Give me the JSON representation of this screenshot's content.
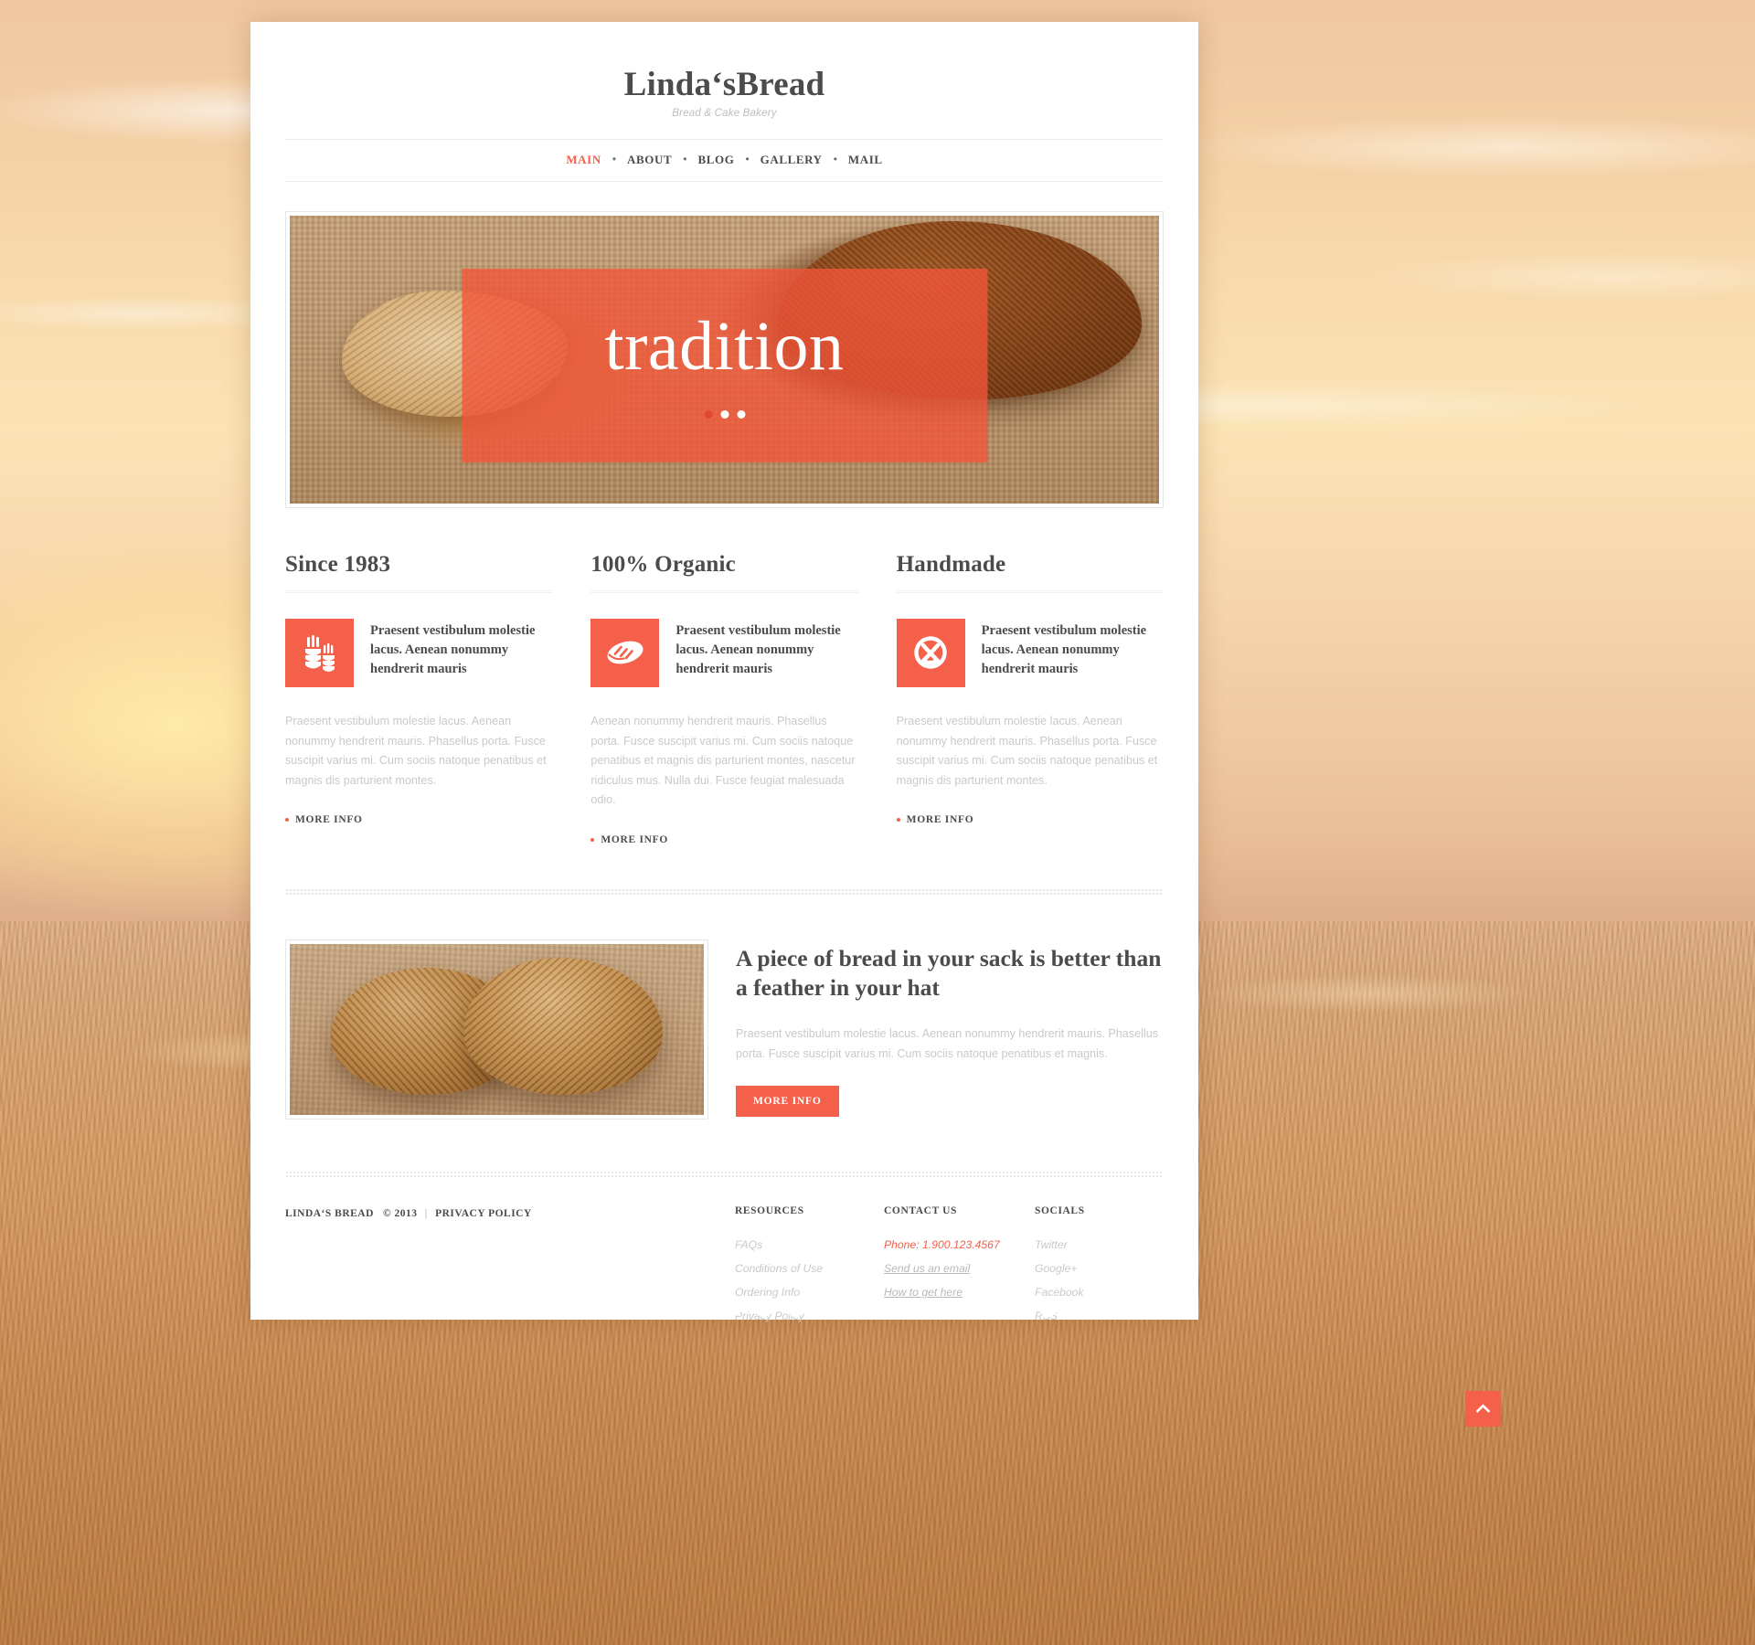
{
  "theme": {
    "accent": "#f4604a",
    "heading_color": "#4b4b4b",
    "muted_text": "#c9c9c9",
    "page_bg": "#ffffff"
  },
  "header": {
    "logo_title": "Linda‘sBread",
    "logo_tagline": "Bread & Cake Bakery"
  },
  "nav": {
    "separator": "•",
    "items": [
      {
        "label": "MAIN",
        "active": true
      },
      {
        "label": "ABOUT",
        "active": false
      },
      {
        "label": "BLOG",
        "active": false
      },
      {
        "label": "GALLERY",
        "active": false
      },
      {
        "label": "MAIL",
        "active": false
      }
    ]
  },
  "hero": {
    "title": "tradition",
    "slide_count": 3,
    "active_slide": 1,
    "overlay_color": "#f45439",
    "image_alt": "Sliced dark rye bread loaf on burlap cloth"
  },
  "features": [
    {
      "title": "Since 1983",
      "icon": "wheat-icon",
      "lead": "Praesent vestibulum molestie lacus. Aenean nonummy hendrerit mauris",
      "body": "Praesent vestibulum molestie lacus. Aenean nonummy hendrerit mauris. Phasellus porta. Fusce suscipit varius mi. Cum sociis natoque penatibus et magnis dis parturient montes.",
      "more_label": "MORE INFO"
    },
    {
      "title": "100% Organic",
      "icon": "bread-loaf-icon",
      "lead": "Praesent vestibulum molestie lacus. Aenean nonummy hendrerit mauris",
      "body": "Aenean nonummy hendrerit mauris. Phasellus porta. Fusce suscipit varius mi. Cum sociis natoque penatibus et magnis dis parturient montes, nascetur ridiculus mus. Nulla dui. Fusce feugiat malesuada odio.",
      "more_label": "MORE INFO"
    },
    {
      "title": "Handmade",
      "icon": "pretzel-icon",
      "lead": "Praesent vestibulum molestie lacus. Aenean nonummy hendrerit mauris",
      "body": "Praesent vestibulum molestie lacus. Aenean nonummy hendrerit mauris. Phasellus porta. Fusce suscipit varius mi. Cum sociis natoque penatibus et magnis dis parturient montes.",
      "more_label": "MORE INFO"
    }
  ],
  "promo": {
    "image_alt": "Two round rustic bread loaves on burlap",
    "title": "A piece of bread in your sack is better than a feather in your hat",
    "body": "Praesent vestibulum molestie lacus. Aenean nonummy hendrerit mauris. Phasellus porta. Fusce suscipit varius mi. Cum sociis natoque penatibus et magnis.",
    "button_label": "MORE INFO"
  },
  "footer": {
    "copyright_name": "LINDA‘S BREAD",
    "copyright_year": "© 2013",
    "separator": "|",
    "privacy_label": "PRIVACY POLICY",
    "columns": [
      {
        "heading": "RESOURCES",
        "links": [
          {
            "label": "FAQs",
            "style": "plain"
          },
          {
            "label": "Conditions of Use",
            "style": "plain"
          },
          {
            "label": "Ordering Info",
            "style": "plain"
          },
          {
            "label": "Privacy Policy",
            "style": "plain"
          }
        ]
      },
      {
        "heading": "CONTACT US",
        "links": [
          {
            "label": "Phone: 1.900.123.4567",
            "style": "phone"
          },
          {
            "label": "Send us an email",
            "style": "underlined"
          },
          {
            "label": "How to get here",
            "style": "underlined"
          }
        ]
      },
      {
        "heading": "SOCIALS",
        "links": [
          {
            "label": "Twitter",
            "style": "plain"
          },
          {
            "label": "Google+",
            "style": "plain"
          },
          {
            "label": "Facebook",
            "style": "plain"
          },
          {
            "label": "RSS",
            "style": "plain"
          }
        ]
      }
    ]
  },
  "back_to_top": {
    "icon": "chevron-up-icon",
    "label": "Back to top"
  }
}
